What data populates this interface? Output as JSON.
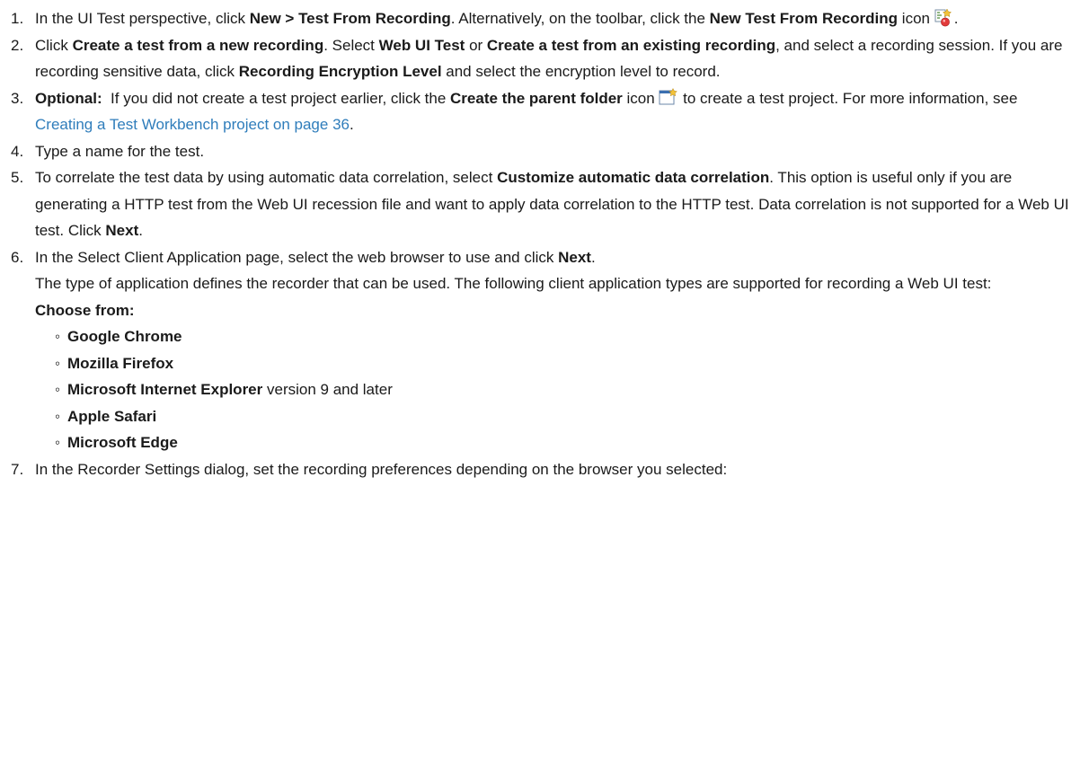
{
  "steps": [
    {
      "num": "1.",
      "parts": {
        "a": "In the UI Test perspective, click ",
        "b1": "New > Test From Recording",
        "c": ". Alternatively, on the toolbar, click the ",
        "b2": "New Test From Recording",
        "d": " icon ",
        "e": "."
      },
      "icon": "new-test-from-recording-icon"
    },
    {
      "num": "2.",
      "parts": {
        "a": "Click ",
        "b1": "Create a test from a new recording",
        "c": ". Select ",
        "b2": "Web UI Test",
        "d": " or ",
        "b3": "Create a test from an existing recording",
        "e": ", and select a recording session. If you are recording sensitive data, click ",
        "b4": "Recording Encryption Level",
        "f": " and select the encryption level to record."
      }
    },
    {
      "num": "3.",
      "parts": {
        "b1": "Optional:",
        "a": "  If you did not create a test project earlier, click the ",
        "b2": "Create the parent folder",
        "c": " icon ",
        "d": " to create a test project. For more information, see ",
        "link": "Creating a Test Workbench project on page 36",
        "e": "."
      },
      "icon": "create-parent-folder-icon"
    },
    {
      "num": "4.",
      "parts": {
        "a": "Type a name for the test."
      }
    },
    {
      "num": "5.",
      "parts": {
        "a": "To correlate the test data by using automatic data correlation, select ",
        "b1": "Customize automatic data correlation",
        "c": ". This option is useful only if you are generating a HTTP test from the Web UI recession file and want to apply data correlation to the HTTP test. Data correlation is not supported for a Web UI test. Click ",
        "b2": "Next",
        "d": "."
      }
    },
    {
      "num": "6.",
      "parts": {
        "a": "In the Select Client Application page, select the web browser to use and click ",
        "b1": "Next",
        "c": ".",
        "p2": "The type of application defines the recorder that can be used. The following client application types are supported for recording a Web UI test:",
        "choose": "Choose from:"
      },
      "options": [
        {
          "bullet": "◦",
          "name": "Google Chrome",
          "suffix": ""
        },
        {
          "bullet": "◦",
          "name": "Mozilla Firefox",
          "suffix": ""
        },
        {
          "bullet": "◦",
          "name": "Microsoft Internet Explorer",
          "suffix": " version 9 and later"
        },
        {
          "bullet": "◦",
          "name": "Apple Safari",
          "suffix": ""
        },
        {
          "bullet": "◦",
          "name": "Microsoft Edge",
          "suffix": ""
        }
      ]
    },
    {
      "num": "7.",
      "parts": {
        "a": "In the Recorder Settings dialog, set the recording preferences depending on the browser you selected:"
      }
    }
  ],
  "colors": {
    "link": "#2f7dbb",
    "text": "#1a1a1a"
  }
}
